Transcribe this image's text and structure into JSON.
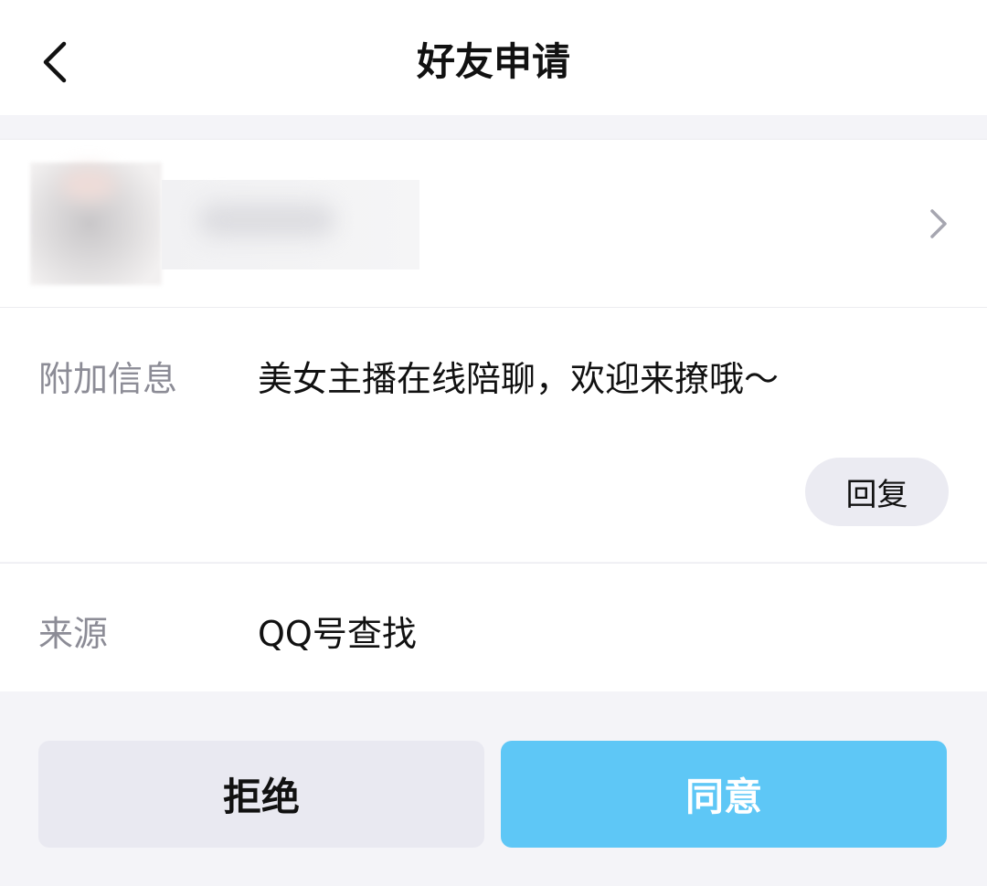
{
  "header": {
    "title": "好友申请",
    "back_icon": "chevron-left-icon"
  },
  "profile": {
    "chevron_icon": "chevron-right-icon"
  },
  "info": {
    "label": "附加信息",
    "message": "美女主播在线陪聊，欢迎来撩哦～",
    "reply_label": "回复"
  },
  "source": {
    "label": "来源",
    "value": "QQ号查找"
  },
  "actions": {
    "reject_label": "拒绝",
    "accept_label": "同意",
    "accept_color": "#5ec7f6",
    "reject_color": "#e9e9f1"
  }
}
